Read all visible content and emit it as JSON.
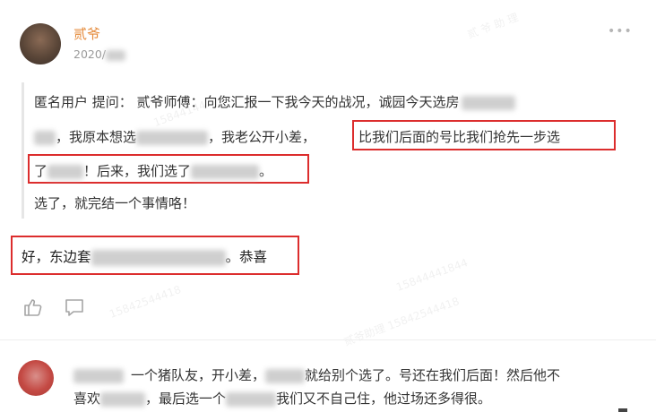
{
  "post": {
    "author": "贰爷",
    "date": "2020/",
    "more_icon": "more-dots-icon"
  },
  "quote": {
    "line1": "匿名用户  提问：  贰爷师傅：向您汇报一下我今天的战况，诚园今天选房",
    "line2_a": "，我原本想选",
    "line2_b": "，我老公开小差，",
    "line2_highlight": "比我们后面的号比我们抢先一步选",
    "line3_a": "了",
    "line3_b": "！后来，我们选了",
    "line3_c": "。",
    "line4": "选了，就完结一个事情咯！"
  },
  "reply": {
    "text_a": "好，东边套",
    "text_b": "。恭喜"
  },
  "actions": {
    "like_icon": "thumbs-up-icon",
    "comment_icon": "comment-icon"
  },
  "comment": {
    "line1_a": "一个猪队友，开小差，",
    "line1_b": "就给别个选了。号还在我们后面！然后他不",
    "line2_a": "喜欢",
    "line2_b": "，最后选一个",
    "line2_c": "我们又不自己住，他过场还多得很。"
  },
  "colors": {
    "author": "#e58a3a",
    "highlight_border": "#dc2d2d"
  }
}
